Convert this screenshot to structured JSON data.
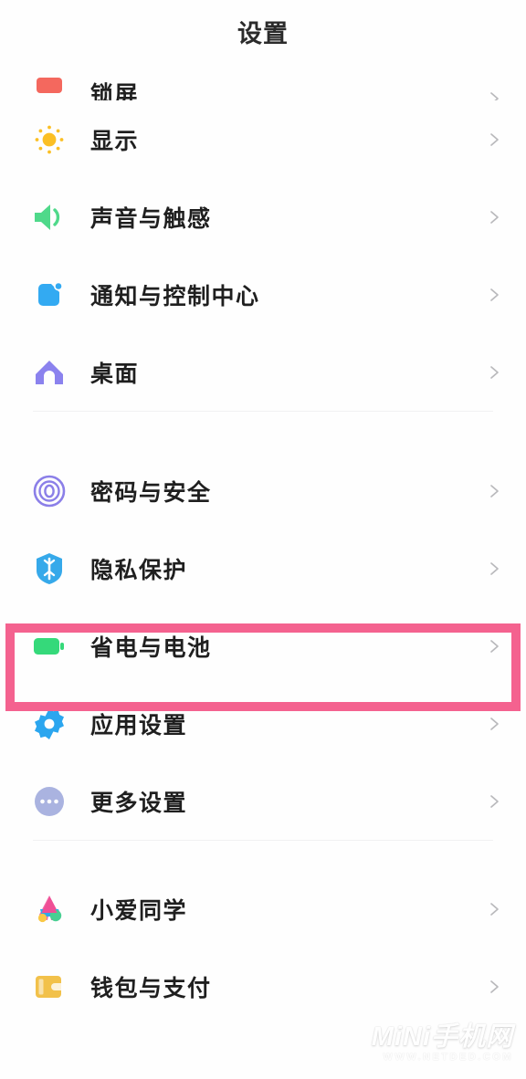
{
  "header": {
    "title": "设置"
  },
  "colors": {
    "highlight_box": "#f4628f",
    "page_bg": "#fefefe",
    "label_text": "#1f1f1f",
    "chevron": "#b9b9bc",
    "divider": "#f1f1f2",
    "lockscreen_icon": "#f4685e",
    "display_icon": "#fbbf24",
    "sound_icon": "#4fd98a",
    "notification_icon": "#33aaf2",
    "home_icon": "#8b82ee",
    "security_icon": "#8b7fe8",
    "privacy_icon": "#36a9ea",
    "battery_icon": "#35d97a",
    "app_settings_icon": "#2ba6ef",
    "more_settings_icon": "#aab3e0",
    "xiaoai_icon_pink": "#ef4f96",
    "xiaoai_icon_blue": "#2fa8e8",
    "xiaoai_icon_green": "#48cf92",
    "xiaoai_icon_yellow": "#f9c846",
    "wallet_icon": "#f2c14a"
  },
  "groups": [
    {
      "name": "group-system",
      "items": [
        {
          "label": "锁屏",
          "icon": "lockscreen-icon",
          "clipped": true,
          "chevron": true
        },
        {
          "label": "显示",
          "icon": "display-icon",
          "clipped": false,
          "chevron": true
        },
        {
          "label": "声音与触感",
          "icon": "sound-vibration-icon",
          "clipped": false,
          "chevron": true
        },
        {
          "label": "通知与控制中心",
          "icon": "notification-icon",
          "clipped": false,
          "chevron": true
        },
        {
          "label": "桌面",
          "icon": "home-screen-icon",
          "clipped": false,
          "chevron": true
        }
      ]
    },
    {
      "name": "group-security",
      "items": [
        {
          "label": "密码与安全",
          "icon": "fingerprint-security-icon",
          "clipped": false,
          "chevron": true
        },
        {
          "label": "隐私保护",
          "icon": "privacy-shield-icon",
          "clipped": false,
          "chevron": true
        },
        {
          "label": "省电与电池",
          "icon": "battery-icon",
          "clipped": false,
          "chevron": true,
          "highlighted": true
        },
        {
          "label": "应用设置",
          "icon": "gear-icon",
          "clipped": false,
          "chevron": true
        },
        {
          "label": "更多设置",
          "icon": "more-dots-icon",
          "clipped": false,
          "chevron": true
        }
      ]
    },
    {
      "name": "group-services",
      "items": [
        {
          "label": "小爱同学",
          "icon": "xiaoai-assistant-icon",
          "clipped": false,
          "chevron": true
        },
        {
          "label": "钱包与支付",
          "icon": "wallet-icon",
          "clipped": false,
          "chevron": true
        }
      ]
    }
  ],
  "watermark": {
    "main": "MiNi手机网",
    "sub": "WWW.NETDED.COM"
  }
}
